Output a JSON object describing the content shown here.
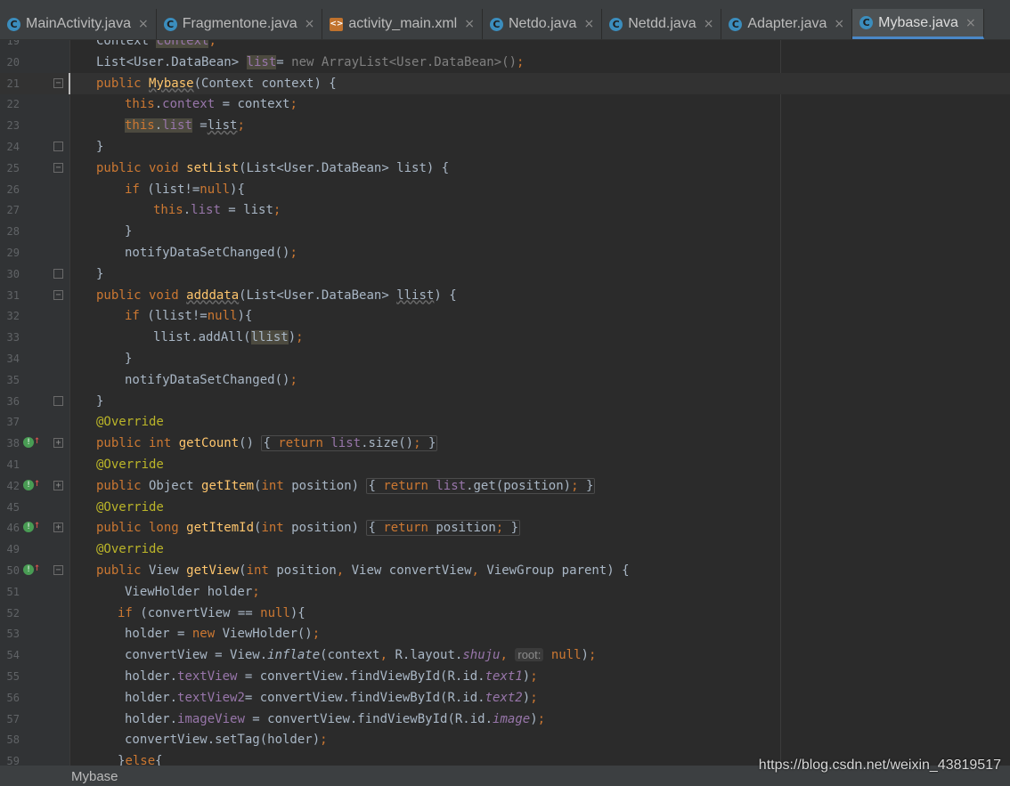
{
  "tabs": [
    {
      "label": "MainActivity.java",
      "icon": "java-class-icon"
    },
    {
      "label": "Fragmentone.java",
      "icon": "java-class-icon"
    },
    {
      "label": "activity_main.xml",
      "icon": "xml-file-icon"
    },
    {
      "label": "Netdo.java",
      "icon": "java-class-icon"
    },
    {
      "label": "Netdd.java",
      "icon": "java-class-icon"
    },
    {
      "label": "Adapter.java",
      "icon": "java-class-icon"
    },
    {
      "label": "Mybase.java",
      "icon": "java-class-icon",
      "active": true
    }
  ],
  "tab_close_glyph": "×",
  "class_icon_glyph": "C",
  "line_numbers": [
    "19",
    "20",
    "21",
    "22",
    "23",
    "24",
    "25",
    "26",
    "27",
    "28",
    "29",
    "30",
    "31",
    "32",
    "33",
    "34",
    "35",
    "36",
    "37",
    "38",
    "41",
    "42",
    "45",
    "46",
    "49",
    "50",
    "51",
    "52",
    "53",
    "54",
    "55",
    "56",
    "57",
    "58",
    "59"
  ],
  "param_hint": "root:",
  "breadcrumb": "Mybase",
  "watermark": "https://blog.csdn.net/weixin_43819517",
  "colors": {
    "keyword": "#cc7832",
    "field": "#9876aa",
    "method": "#ffc66d",
    "annotation": "#bbb529",
    "text": "#a9b7c6",
    "background": "#2b2b2b",
    "accent": "#4a88c7"
  }
}
